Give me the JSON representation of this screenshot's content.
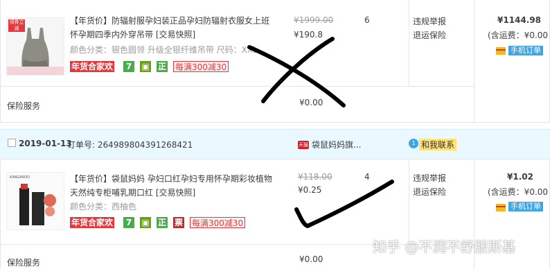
{
  "order1": {
    "title_line1": "【年货价】防辐射服孕妇装正品孕妇防辐射衣服女上班",
    "title_line2": "怀孕期四季内外穿吊带 [交易快照]",
    "sku": "颜色分类：银色圆领 升级全银纤维吊带  尺码：XXL",
    "thumb_badge": "领券立减",
    "tag_promo": "年货合家欢",
    "tag_seven": "7",
    "tag_cert": "正",
    "tag_coupon": "每满300减30",
    "original_price": "¥1999.00",
    "price": "¥190.8",
    "quantity": "6",
    "action_report": "违规举报",
    "action_insurance": "退运保险",
    "total": "¥1144.98",
    "shipping_note": "(含运费：¥0.00",
    "phone_order": "手机订单",
    "service_label": "保险服务",
    "service_price": "¥0.00"
  },
  "order2_header": {
    "date": "2019-01-13",
    "order_label": "订单号: 264989804391268421",
    "shop": "袋鼠妈妈旗...",
    "shop_icon": "天猫",
    "contact_num": "1",
    "contact": "和我联系"
  },
  "order2": {
    "title_line1": "【年货价】袋鼠妈妈 孕妇口红孕妇专用怀孕期彩妆植物",
    "title_line2": "天然纯专柜哺乳期口红 [交易快照]",
    "sku": "颜色分类：西柚色",
    "brand_text": "KANGAROO",
    "tag_promo": "年货合家欢",
    "tag_seven": "7",
    "tag_cert": "正",
    "tag_invoice": "票",
    "tag_coupon": "每满300减30",
    "original_price": "¥118.00",
    "price": "¥0.25",
    "quantity": "4",
    "action_report": "违规举报",
    "action_insurance": "退运保险",
    "total": "¥1.02",
    "shipping_note": "(含运费：¥0.00",
    "phone_order": "手机订单",
    "service_label": "保险服务",
    "service_price": "¥0.00"
  },
  "watermark": "知乎 @不润不舒服斯基",
  "colors": {
    "accent_red": "#e4393c",
    "link_blue": "#41a5e1",
    "header_bg": "#eaf8ff",
    "ink": "#000000"
  },
  "icons": [
    "checkbox-icon",
    "tmall-icon",
    "wangwang-icon",
    "bank-card-icon",
    "cross-mark-icon",
    "check-mark-icon"
  ]
}
